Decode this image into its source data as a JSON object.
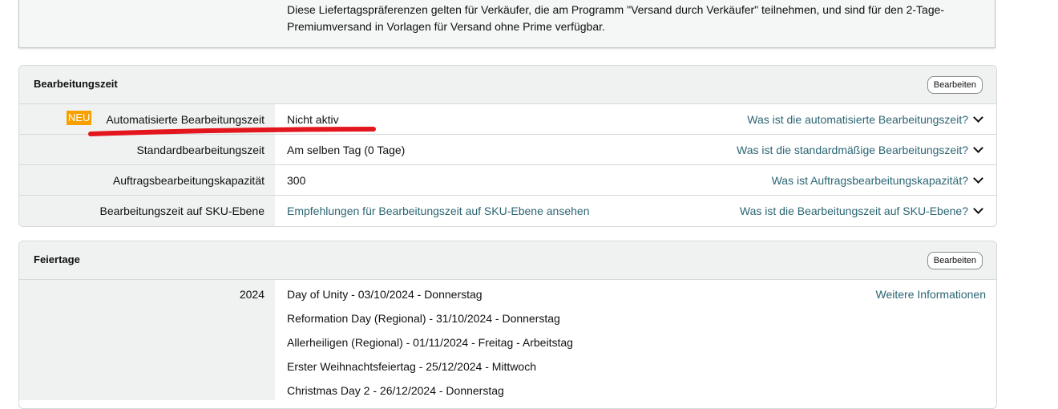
{
  "info": {
    "text": "Diese Liefertagspräferenzen gelten für Verkäufer, die am Programm \"Versand durch Verkäufer\" teilnehmen, und sind für den 2-Tage-Premiumversand in Vorlagen für Versand ohne Prime verfügbar."
  },
  "processing": {
    "title": "Bearbeitungszeit",
    "edit_label": "Bearbeiten",
    "new_badge": "NEU",
    "rows": [
      {
        "label": "Automatisierte Bearbeitungszeit",
        "value": "Nicht aktiv",
        "help": "Was ist die automatisierte Bearbeitungszeit?"
      },
      {
        "label": "Standardbearbeitungszeit",
        "value": "Am selben Tag (0 Tage)",
        "help": "Was ist die standardmäßige Bearbeitungszeit?"
      },
      {
        "label": "Auftragsbearbeitungskapazität",
        "value": "300",
        "help": "Was ist Auftragsbearbeitungskapazität?"
      },
      {
        "label": "Bearbeitungszeit auf SKU-Ebene",
        "value": "Empfehlungen für Bearbeitungszeit auf SKU-Ebene ansehen",
        "help": "Was ist die Bearbeitungszeit auf SKU-Ebene?"
      }
    ]
  },
  "holidays": {
    "title": "Feiertage",
    "edit_label": "Bearbeiten",
    "year": "2024",
    "more_info": "Weitere Informationen",
    "items": [
      "Day of Unity - 03/10/2024 -  Donnerstag",
      "Reformation Day (Regional) - 31/10/2024 -  Donnerstag",
      "Allerheiligen (Regional) - 01/11/2024 -  Freitag  - Arbeitstag",
      "Erster Weihnachtsfeiertag - 25/12/2024 -  Mittwoch",
      "Christmas Day 2 - 26/12/2024 -  Donnerstag"
    ]
  },
  "colors": {
    "link": "#2b6573",
    "badge": "#f7a000",
    "annotation": "#e3161e"
  }
}
